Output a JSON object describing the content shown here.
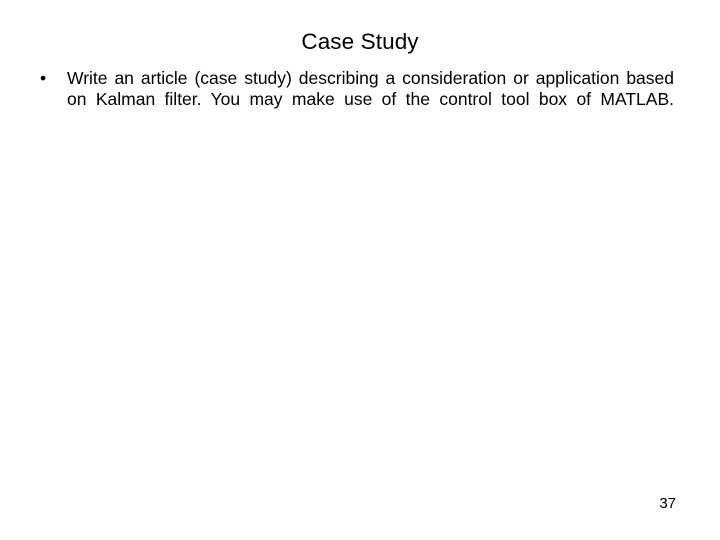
{
  "slide": {
    "title": "Case Study",
    "background_color": "#ffffff",
    "text_color": "#000000",
    "page_number": "37",
    "bullets": [
      {
        "marker": "•",
        "text": "Write an article (case study) describing a consideration or application based on Kalman filter. You may make use of the control tool box of MATLAB."
      }
    ]
  }
}
